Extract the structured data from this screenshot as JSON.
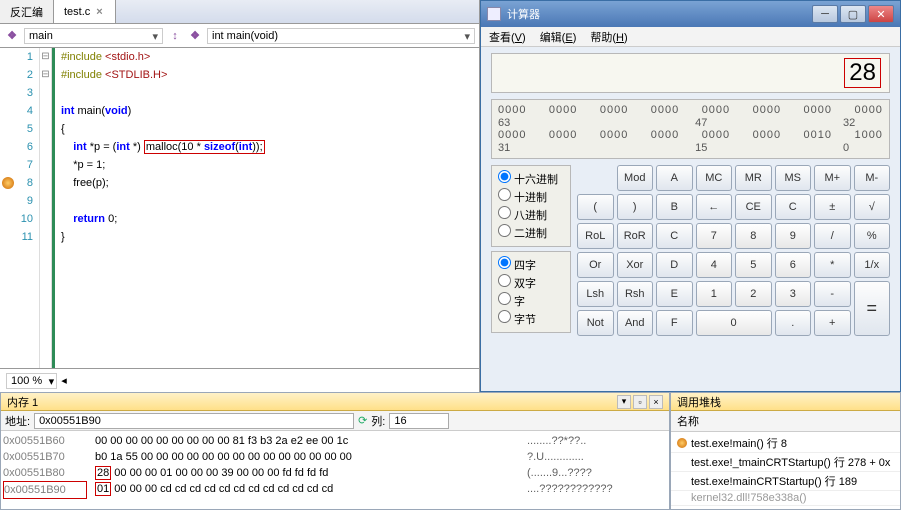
{
  "tabs": {
    "items": [
      {
        "label": "反汇编"
      },
      {
        "label": "test.c"
      }
    ],
    "activeIndex": 1
  },
  "toolbar": {
    "scope": "main",
    "func": "int main(void)"
  },
  "code": {
    "lines": [
      {
        "n": 1,
        "fold": "⊟",
        "html": "<span class='pp'>#include</span> <span class='str'>&lt;stdio.h&gt;</span>"
      },
      {
        "n": 2,
        "fold": "",
        "html": "<span class='pp'>#include</span> <span class='str'>&lt;STDLIB.H&gt;</span>"
      },
      {
        "n": 3,
        "fold": "",
        "html": ""
      },
      {
        "n": 4,
        "fold": "⊟",
        "html": "<span class='kw'>int</span> main(<span class='kw'>void</span>)"
      },
      {
        "n": 5,
        "fold": "",
        "html": "{"
      },
      {
        "n": 6,
        "fold": "",
        "html": "    <span class='kw'>int</span> *p = (<span class='kw'>int</span> *) <span class='hl'>malloc(10 * <span class='kw'>sizeof</span>(<span class='kw'>int</span>));</span>"
      },
      {
        "n": 7,
        "fold": "",
        "html": "    *p = 1;"
      },
      {
        "n": 8,
        "fold": "",
        "bp": true,
        "html": "    free(p);"
      },
      {
        "n": 9,
        "fold": "",
        "html": ""
      },
      {
        "n": 10,
        "fold": "",
        "html": "    <span class='kw'>return</span> 0;"
      },
      {
        "n": 11,
        "fold": "",
        "html": "}"
      }
    ]
  },
  "zoom": "100 %",
  "calc": {
    "title": "计算器",
    "menu": [
      {
        "k": "V",
        "t": "查看"
      },
      {
        "k": "E",
        "t": "编辑"
      },
      {
        "k": "H",
        "t": "帮助"
      }
    ],
    "display": "28",
    "bits_row1": [
      "0000",
      "0000",
      "0000",
      "0000",
      "0000",
      "0000",
      "0000",
      "0000"
    ],
    "bits_row2": [
      "0000",
      "0000",
      "0000",
      "0000",
      "0000",
      "0000",
      "0010",
      "1000"
    ],
    "bits_idx1": [
      "63",
      "",
      "",
      "",
      "47",
      "",
      "",
      "32"
    ],
    "bits_idx2": [
      "31",
      "",
      "",
      "",
      "15",
      "",
      "",
      "0"
    ],
    "radios_base": [
      {
        "l": "十六进制",
        "c": true
      },
      {
        "l": "十进制"
      },
      {
        "l": "八进制"
      },
      {
        "l": "二进制"
      }
    ],
    "radios_word": [
      {
        "l": "四字",
        "c": true
      },
      {
        "l": "双字"
      },
      {
        "l": "字"
      },
      {
        "l": "字节"
      }
    ],
    "buttons": [
      [
        "",
        "Mod",
        "A",
        "MC",
        "MR",
        "MS",
        "M+",
        "M-"
      ],
      [
        "(",
        ")",
        "B",
        "←",
        "CE",
        "C",
        "±",
        "√"
      ],
      [
        "RoL",
        "RoR",
        "C",
        "7",
        "8",
        "9",
        "/",
        "%"
      ],
      [
        "Or",
        "Xor",
        "D",
        "4",
        "5",
        "6",
        "*",
        "1/x"
      ],
      [
        "Lsh",
        "Rsh",
        "E",
        "1",
        "2",
        "3",
        "-",
        "="
      ],
      [
        "Not",
        "And",
        "F",
        "0",
        "",
        ".",
        "+",
        ""
      ]
    ]
  },
  "memory": {
    "title": "内存 1",
    "addr_label": "地址:",
    "addr": "0x00551B90",
    "col_label": "列:",
    "cols": "16",
    "rows": [
      {
        "a": "0x00551B60",
        "h": "00 00 00 00 00 00 00 00 00 81 f3 b3 2a e2 ee 00 1c",
        "s": "........??*??.."
      },
      {
        "a": "0x00551B70",
        "h": "b0 1a 55 00 00 00 00 00 00 00 00 00 00 00 00 00 00",
        "s": "?.U............."
      },
      {
        "a": "0x00551B80",
        "h": "<span class='hlbyte'>28</span> 00 00 00 01 00 00 00 39 00 00 00 fd fd fd fd",
        "s": "(.......9...????"
      },
      {
        "a": "0x00551B90",
        "h": "<span class='hlbyte'>01</span> 00 00 00 cd cd cd cd cd cd cd cd cd cd cd cd",
        "s": "....????????????",
        "hlA": true
      }
    ]
  },
  "stack": {
    "title": "调用堆栈",
    "name_hdr": "名称",
    "frames": [
      {
        "cur": true,
        "t": "test.exe!main() 行 8"
      },
      {
        "t": "test.exe!_tmainCRTStartup() 行 278 + 0x"
      },
      {
        "t": "test.exe!mainCRTStartup() 行 189"
      },
      {
        "t": "kernel32.dll!758e338a()",
        "dim": true
      }
    ]
  }
}
